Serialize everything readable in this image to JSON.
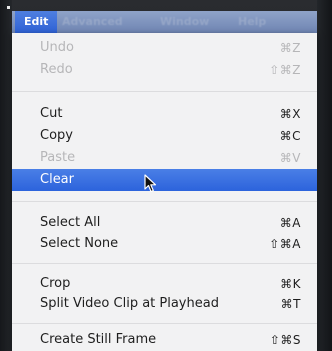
{
  "menubar": {
    "active_menu": "Edit",
    "other_menus": [
      "Advanced",
      "Window",
      "Help"
    ]
  },
  "menu": {
    "items": [
      {
        "label": "Undo",
        "shortcut": "⌘Z",
        "enabled": false
      },
      {
        "label": "Redo",
        "shortcut": "⇧⌘Z",
        "enabled": false
      },
      {
        "label": "Cut",
        "shortcut": "⌘X",
        "enabled": true
      },
      {
        "label": "Copy",
        "shortcut": "⌘C",
        "enabled": true
      },
      {
        "label": "Paste",
        "shortcut": "⌘V",
        "enabled": false
      },
      {
        "label": "Clear",
        "shortcut": "",
        "enabled": true,
        "highlighted": true
      },
      {
        "label": "Select All",
        "shortcut": "⌘A",
        "enabled": true
      },
      {
        "label": "Select None",
        "shortcut": "⇧⌘A",
        "enabled": true
      },
      {
        "label": "Crop",
        "shortcut": "⌘K",
        "enabled": true
      },
      {
        "label": "Split Video Clip at Playhead",
        "shortcut": "⌘T",
        "enabled": true
      },
      {
        "label": "Create Still Frame",
        "shortcut": "⇧⌘S",
        "enabled": true
      }
    ]
  },
  "colors": {
    "highlight": "#2c63dc",
    "disabled_text": "#b6b6b8",
    "menu_background": "#f2f2f3"
  }
}
